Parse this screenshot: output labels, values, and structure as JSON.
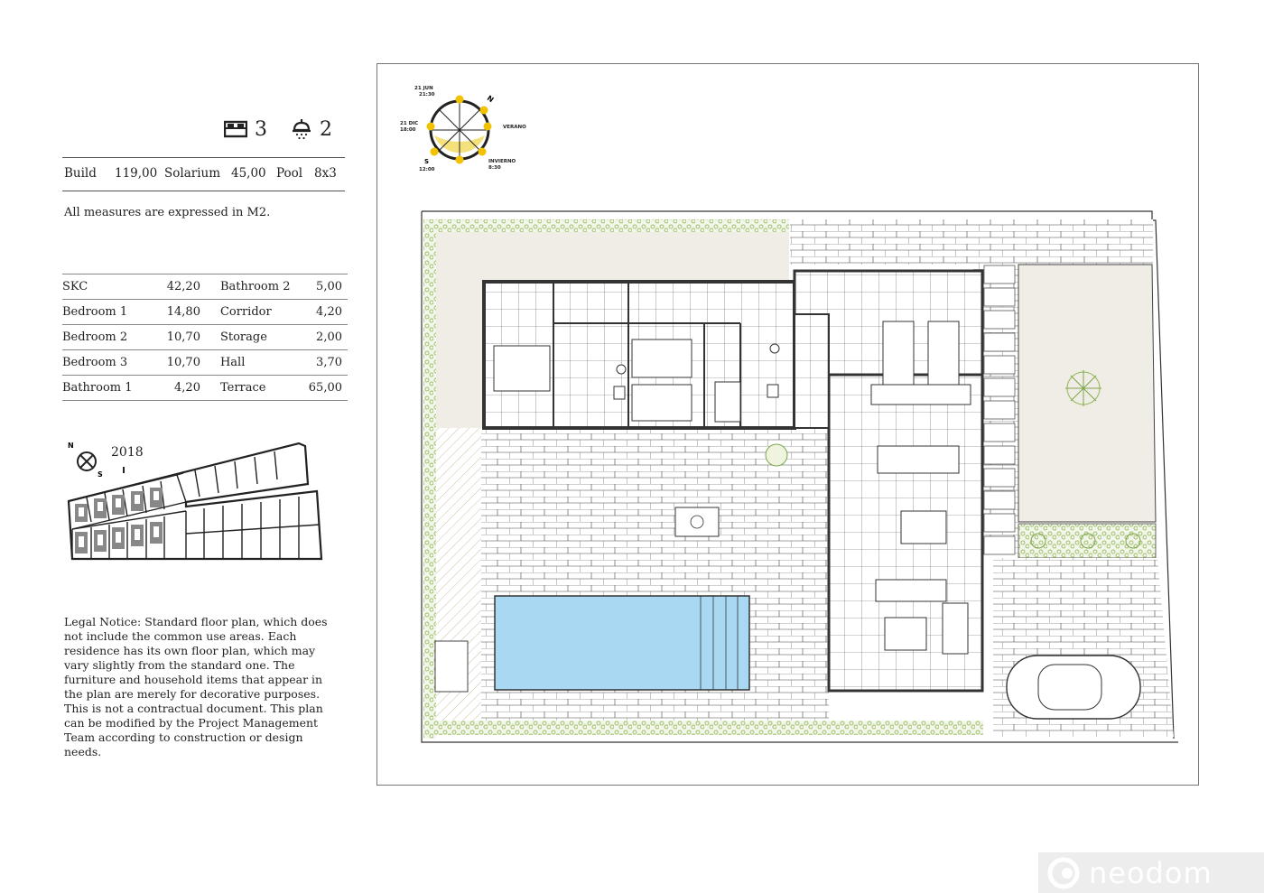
{
  "header": {
    "bedrooms": "3",
    "bathrooms": "2",
    "bed_icon": "bed-icon",
    "bath_icon": "shower-icon"
  },
  "summary": {
    "build_label": "Build",
    "build_value": "119,00",
    "solarium_label": "Solarium",
    "solarium_value": "45,00",
    "pool_label": "Pool",
    "pool_value": "8x3"
  },
  "measures_note": "All measures are expressed in M2.",
  "rooms": [
    {
      "name": "SKC",
      "value": "42,20",
      "name2": "Bathroom 2",
      "value2": "5,00"
    },
    {
      "name": "Bedroom 1",
      "value": "14,80",
      "name2": "Corridor",
      "value2": "4,20"
    },
    {
      "name": "Bedroom 2",
      "value": "10,70",
      "name2": "Storage",
      "value2": "2,00"
    },
    {
      "name": "Bedroom 3",
      "value": "10,70",
      "name2": "Hall",
      "value2": "3,70"
    },
    {
      "name": "Bathroom 1",
      "value": "4,20",
      "name2": "Terrace",
      "value2": "65,00"
    }
  ],
  "site_plan": {
    "year": "2018",
    "north": "N",
    "south": "S"
  },
  "legal_notice": "Legal Notice: Standard floor plan, which does not include the common use areas. Each residence has its own floor plan, which may vary slightly from the standard one. The furniture and household items that appear in the plan are merely for decorative purposes. This is not a contractual document. This plan can be modified by the Project Management Team according to construction or design needs.",
  "compass": {
    "jun": "21 JUN",
    "jun_time": "21:30",
    "dec": "21 DIC",
    "dec_time": "18:00",
    "verano": "VERANO",
    "invierno": "INVIERNO",
    "invierno_time": "8:30",
    "south_time": "12:00",
    "north": "N",
    "south": "S",
    "sun_color": "#f2c200"
  },
  "colors": {
    "pool": "#a9d9f2",
    "garden": "#efede6",
    "hedge": "#9fbf6a"
  },
  "watermark": {
    "brand": "neodom",
    "logo_icon": "neodom-logo-icon"
  }
}
